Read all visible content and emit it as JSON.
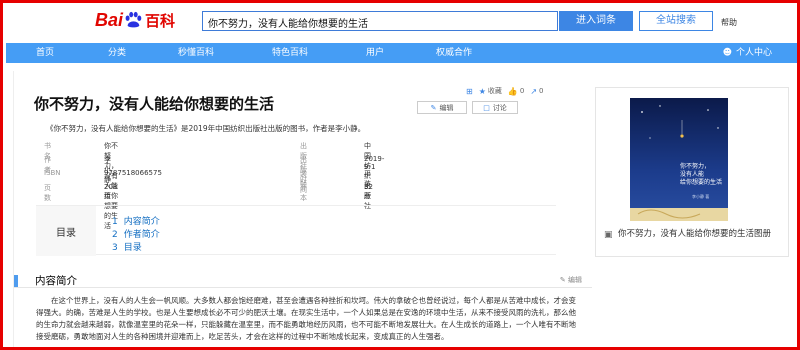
{
  "header": {
    "logo_bai": "Bai",
    "logo_du": "du",
    "logo_baike": "百科",
    "search_value": "你不努力，没有人能给你想要的生活",
    "enter_label": "进入词条",
    "search_label": "全站搜索",
    "help_label": "帮助"
  },
  "nav": {
    "items": [
      "首页",
      "分类",
      "秒懂百科",
      "特色百科",
      "用户",
      "权威合作"
    ],
    "user_center": "个人中心"
  },
  "entry": {
    "title": "你不努力，没有人能给你想要的生活",
    "edit_label": "编辑",
    "discuss_label": "讨论",
    "favorite_label": "收藏",
    "like_count": "0",
    "share_count": "0",
    "summary": "《你不努力，没有人能给你想要的生活》是2019年中国纺织出版社出版的图书，作者是李小静。"
  },
  "info": [
    {
      "label": "书　名",
      "value": "你不努力，没有人能给你想要的生活"
    },
    {
      "label": "作　者",
      "value": "李小静"
    },
    {
      "label": "ISBN",
      "value": "9787518066575"
    },
    {
      "label": "页　数",
      "value": "208页"
    },
    {
      "label": "出版社",
      "value": "中国纺织出版社"
    },
    {
      "label": "出版时间",
      "value": "2019-9-1"
    },
    {
      "label": "装　帧",
      "value": "平装"
    },
    {
      "label": "开　本",
      "value": "32开"
    }
  ],
  "toc": {
    "title": "目录",
    "items": [
      {
        "num": "1",
        "label": "内容简介"
      },
      {
        "num": "2",
        "label": "作者简介"
      },
      {
        "num": "3",
        "label": "目录"
      }
    ]
  },
  "section": {
    "title": "内容简介",
    "edit_label": "编辑",
    "text": "在这个世界上，没有人的人生会一帆风顺。大多数人都会饱经磨难，甚至会遭遇各种挫折和坎坷。伟大的拿破仑也曾经说过，每个人都是从苦难中成长，才会变得强大。的确，苦难是人生的学校。也是人生要想成长必不可少的肥沃土壤。在现实生活中，一个人如果总是在安逸的环境中生活，从来不接受风雨的洗礼，那么他的生命力就会越来越弱，就像温室里的花朵一样，只能躲藏在温室里，而不能勇敢地经历风雨，也不可能不断地发展壮大。在人生成长的道路上，一个人唯有不断地接受磨砺，勇敢地面对人生的各种困境并迎难而上，吃足苦头，才会在这样的过程中不断地成长起来，变成真正的人生强者。"
  },
  "side": {
    "caption": "你不努力，没有人能给你想要的生活图册",
    "cover_title_lines": [
      "你不努力，",
      "没有人能",
      "给你想要的生活"
    ],
    "cover_author": "李小静 著"
  }
}
